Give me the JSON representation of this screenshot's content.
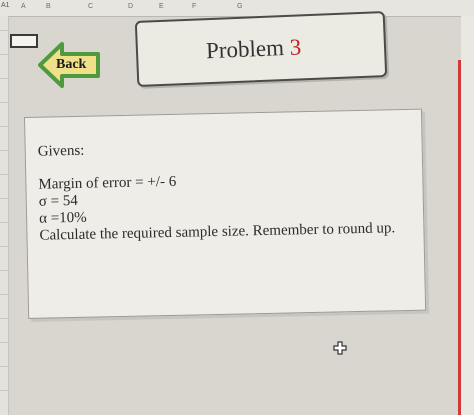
{
  "spreadsheet": {
    "name_box": "A1",
    "column_letters": [
      "A",
      "B",
      "C",
      "D",
      "E",
      "F",
      "G"
    ]
  },
  "back_button": {
    "label": "Back"
  },
  "title": {
    "prefix": "Problem ",
    "number": "3"
  },
  "problem": {
    "givens_heading": "Givens:",
    "margin_of_error": "Margin of error = +/- 6",
    "sigma": "σ = 54",
    "alpha": "α =10%",
    "instruction": "Calculate the required sample size. Remember to round up."
  },
  "colors": {
    "title_number": "#c81e1e",
    "back_arrow": "#4f9a3c",
    "back_arrow_fill": "#f0e08a"
  },
  "icons": {
    "cursor": "plus-cursor-icon",
    "back": "left-arrow-icon"
  }
}
